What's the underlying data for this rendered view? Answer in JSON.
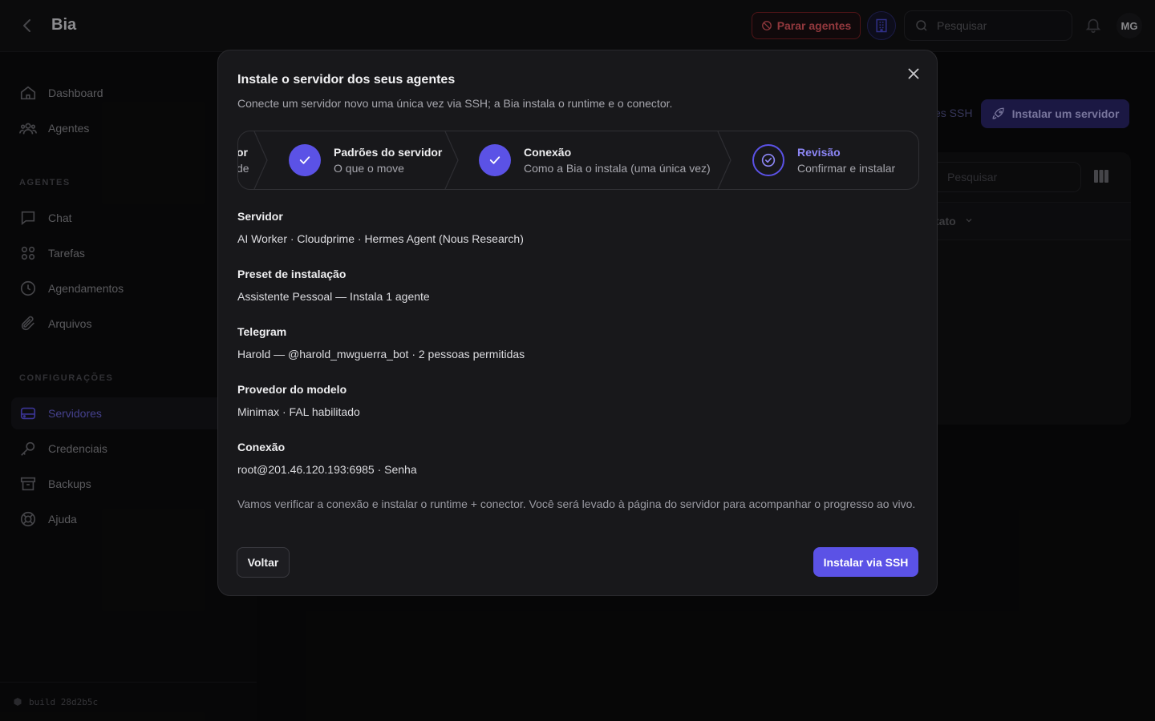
{
  "app": {
    "title": "Bia"
  },
  "header": {
    "stop_agents_label": "Parar agentes",
    "search_placeholder": "Pesquisar",
    "avatar_initials": "MG"
  },
  "sidebar": {
    "items_top": [
      {
        "label": "Dashboard",
        "icon": "home-icon"
      },
      {
        "label": "Agentes",
        "icon": "users-icon"
      }
    ],
    "section_agents": "AGENTES",
    "items_agents": [
      {
        "label": "Chat",
        "icon": "chat-icon"
      },
      {
        "label": "Tarefas",
        "icon": "grid-icon"
      },
      {
        "label": "Agendamentos",
        "icon": "clock-icon"
      },
      {
        "label": "Arquivos",
        "icon": "paperclip-icon"
      }
    ],
    "section_config": "CONFIGURAÇÕES",
    "items_config": [
      {
        "label": "Servidores",
        "icon": "server-icon",
        "active": true
      },
      {
        "label": "Credenciais",
        "icon": "key-icon"
      },
      {
        "label": "Backups",
        "icon": "archive-icon"
      },
      {
        "label": "Ajuda",
        "icon": "lifebuoy-icon"
      }
    ],
    "build": "build 28d2b5c"
  },
  "background": {
    "ssh_keys_partial": "es SSH",
    "install_server_label": "Instalar um servidor",
    "search_placeholder": "Pesquisar",
    "contact_partial": "tato"
  },
  "modal": {
    "title": "Instale o servidor dos seus agentes",
    "subtitle": "Conecte um servidor novo uma única vez via SSH; a Bia instala o runtime e o conector.",
    "steps": [
      {
        "title": "or",
        "desc": "de",
        "state": "partial"
      },
      {
        "title": "Padrões do servidor",
        "desc": "O que o move",
        "state": "done"
      },
      {
        "title": "Conexão",
        "desc": "Como a Bia o instala (uma única vez)",
        "state": "done"
      },
      {
        "title": "Revisão",
        "desc": "Confirmar e instalar",
        "state": "current"
      }
    ],
    "summary": [
      {
        "label": "Servidor",
        "value": "AI Worker · Cloudprime · Hermes Agent (Nous Research)"
      },
      {
        "label": "Preset de instalação",
        "value": "Assistente Pessoal — Instala 1 agente"
      },
      {
        "label": "Telegram",
        "value": "Harold — @harold_mwguerra_bot · 2 pessoas permitidas"
      },
      {
        "label": "Provedor do modelo",
        "value": "Minimax · FAL habilitado"
      },
      {
        "label": "Conexão",
        "value": "root@201.46.120.193:6985 · Senha"
      }
    ],
    "note": "Vamos verificar a conexão e instalar o runtime + conector. Você será levado à página do servidor para acompanhar o progresso ao vivo.",
    "back_label": "Voltar",
    "install_label": "Instalar via SSH"
  },
  "colors": {
    "accent": "#5b52e6",
    "danger": "#e0575f",
    "background": "#0a0a0b",
    "modal": "#18181b"
  }
}
